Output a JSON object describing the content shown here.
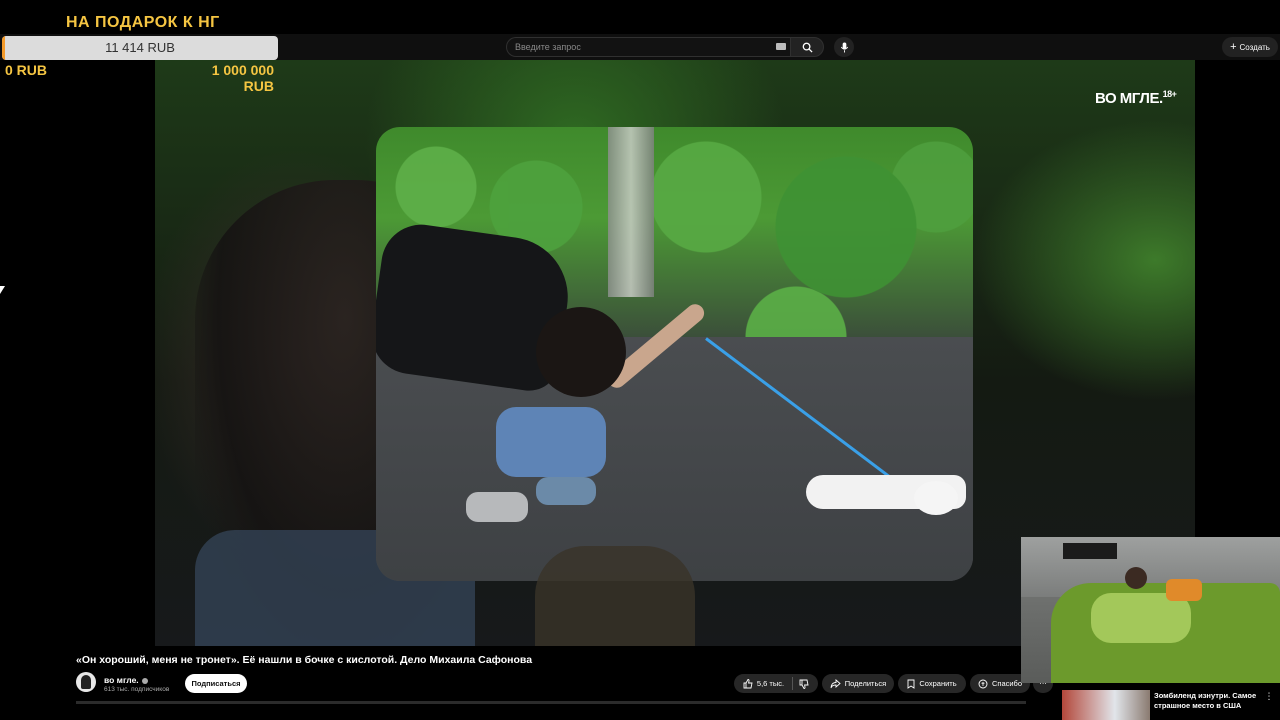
{
  "donation_goal": {
    "title": "НА ПОДАРОК К НГ",
    "current": "11 414 RUB",
    "progress_fraction": 0.0114,
    "min_label": "0 RUB",
    "max_label": "1 000 000 RUB",
    "fill_color": "#f39a2a",
    "text_color": "#f5c542"
  },
  "header": {
    "search_placeholder": "Введите запрос",
    "search_icon": "search-icon",
    "mic_icon": "mic-icon",
    "create_label": "Создать"
  },
  "video": {
    "channel_watermark": "ВО МГЛЕ.",
    "age_rating": "18+",
    "title": "«Он хороший, меня не тронет». Её нашли в бочке с кислотой. Дело Михаила Сафонова"
  },
  "channel": {
    "name": "во мгле.",
    "subscribers": "613 тыс. подписчиков",
    "subscribe_label": "Подписаться"
  },
  "actions": {
    "likes": "5,6 тыс.",
    "share_label": "Поделиться",
    "save_label": "Сохранить",
    "thanks_label": "Спасибо",
    "more_label": "⋯"
  },
  "recommendation": {
    "title": "Зомбиленд изнутри. Самое страшное место в США (на...",
    "more_label": "⋮"
  }
}
